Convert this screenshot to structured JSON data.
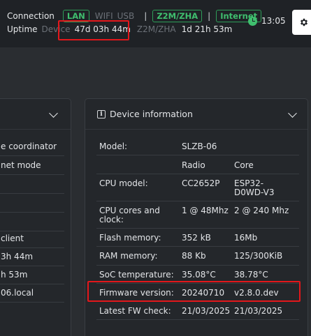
{
  "header": {
    "connection_label": "Connection",
    "conn_lan": "LAN",
    "conn_wifi": "WIFI",
    "conn_usb": "USB",
    "sep": "|",
    "badge_z2m": "Z2M/ZHA",
    "badge_internet": "Internet",
    "uptime_label": "Uptime",
    "device_label": "Device",
    "device_uptime": "47d 03h 44m",
    "z2m_label": "Z2M/ZHA",
    "z2m_uptime": "1d 21h 53m",
    "time": "13:05",
    "colors": {
      "accent": "#3fbf6e",
      "highlight": "#e3171b"
    }
  },
  "left_card": {
    "rows": [
      "e coordinator",
      "net mode",
      "",
      "",
      "client",
      "3h 44m",
      "h 53m",
      "06.local",
      ""
    ]
  },
  "device_info": {
    "title": "Device information",
    "rows": [
      {
        "label": "Model:",
        "v1": "SLZB-06",
        "v2": ""
      },
      {
        "label": "",
        "v1": "Radio",
        "v2": "Core"
      },
      {
        "label": "CPU model:",
        "v1": "CC2652P",
        "v2": "ESP32-D0WD-V3"
      },
      {
        "label": "CPU cores and clock:",
        "v1": "1 @ 48Mhz",
        "v2": "2 @ 240 Mhz"
      },
      {
        "label": "Flash memory:",
        "v1": "352 kB",
        "v2": "16Mb"
      },
      {
        "label": "RAM memory:",
        "v1": "88 Kb",
        "v2": "125/300KiB"
      },
      {
        "label": "SoC temperature:",
        "v1": "35.08°C",
        "v2": "38.78°C"
      },
      {
        "label": "Firmware version:",
        "v1": "20240710",
        "v2": "v2.8.0.dev"
      },
      {
        "label": "Latest FW check:",
        "v1": "21/03/2025",
        "v2": "21/03/2025"
      }
    ]
  }
}
